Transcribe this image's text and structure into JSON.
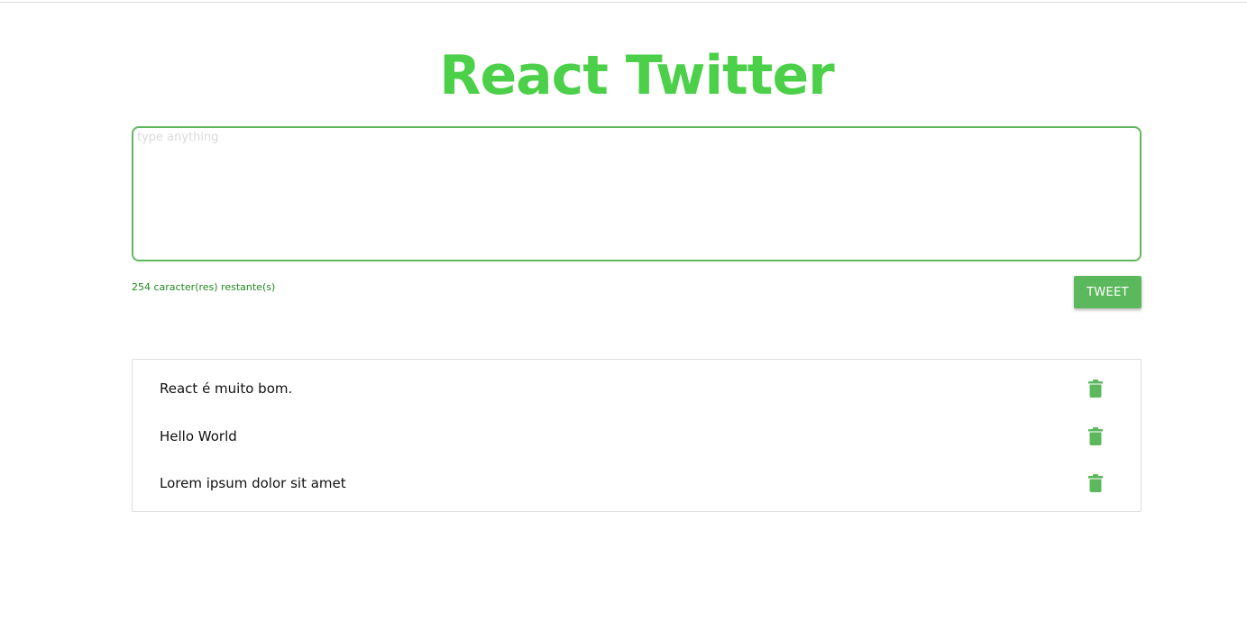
{
  "header": {
    "title": "React Twitter"
  },
  "composer": {
    "placeholder": "type anything",
    "value": "",
    "counter_text": "254 caracter(res) restante(s)",
    "tweet_button_label": "TWEET"
  },
  "tweets": [
    {
      "text": "React é muito bom.",
      "delete_icon": "trash-icon"
    },
    {
      "text": "Hello World",
      "delete_icon": "trash-icon"
    },
    {
      "text": "Lorem ipsum dolor sit amet",
      "delete_icon": "trash-icon"
    }
  ],
  "colors": {
    "title_green": "#4cd04a",
    "accent_green": "#5cb85c",
    "counter_green": "#1f8a1f",
    "input_border": "#5fb85f"
  }
}
